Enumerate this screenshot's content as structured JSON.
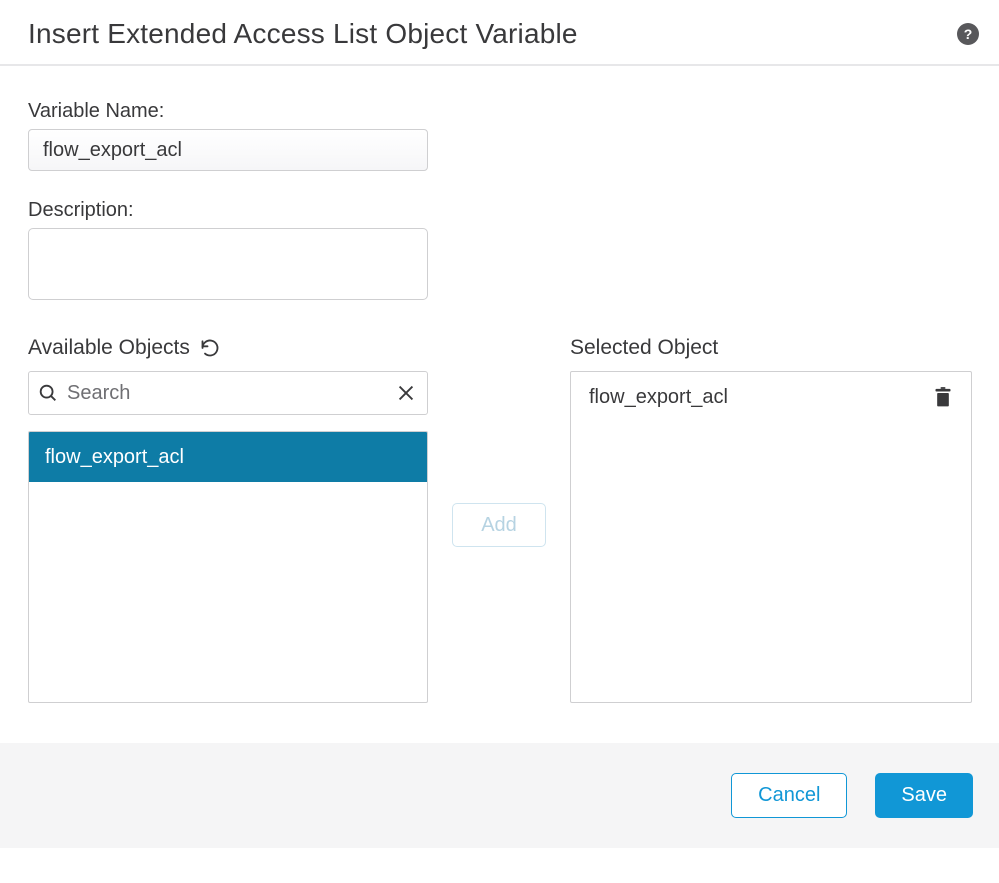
{
  "header": {
    "title": "Insert Extended Access List Object Variable"
  },
  "fields": {
    "variable_name_label": "Variable Name:",
    "variable_name_value": "flow_export_acl",
    "description_label": "Description:",
    "description_value": ""
  },
  "available": {
    "header": "Available Objects",
    "search_placeholder": "Search",
    "search_value": "",
    "items": [
      {
        "label": "flow_export_acl",
        "selected": true
      }
    ]
  },
  "transfer": {
    "add_label": "Add"
  },
  "selected": {
    "header": "Selected Object",
    "items": [
      {
        "label": "flow_export_acl"
      }
    ]
  },
  "footer": {
    "cancel_label": "Cancel",
    "save_label": "Save"
  },
  "icons": {
    "help": "help-icon",
    "refresh": "refresh-icon",
    "search": "search-icon",
    "clear": "clear-x-icon",
    "trash": "trash-icon"
  }
}
